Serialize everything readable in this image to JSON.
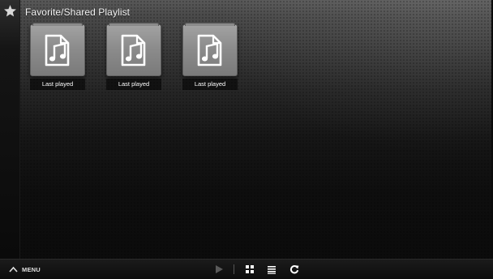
{
  "header": {
    "title": "Favorite/Shared Playlist",
    "icon": "star-icon"
  },
  "playlists": [
    {
      "label": "Last played",
      "icon": "music-file-icon"
    },
    {
      "label": "Last played",
      "icon": "music-file-icon"
    },
    {
      "label": "Last played",
      "icon": "music-file-icon"
    }
  ],
  "bottom_bar": {
    "menu_label": "MENU",
    "menu_icon": "chevron-up-icon",
    "controls": [
      "play-icon",
      "grid-view-icon",
      "list-view-icon",
      "refresh-icon"
    ]
  },
  "colors": {
    "text": "#f2f2f2",
    "tile_gray": "#8c8c8c",
    "play_disabled": "#5a5a5a"
  }
}
